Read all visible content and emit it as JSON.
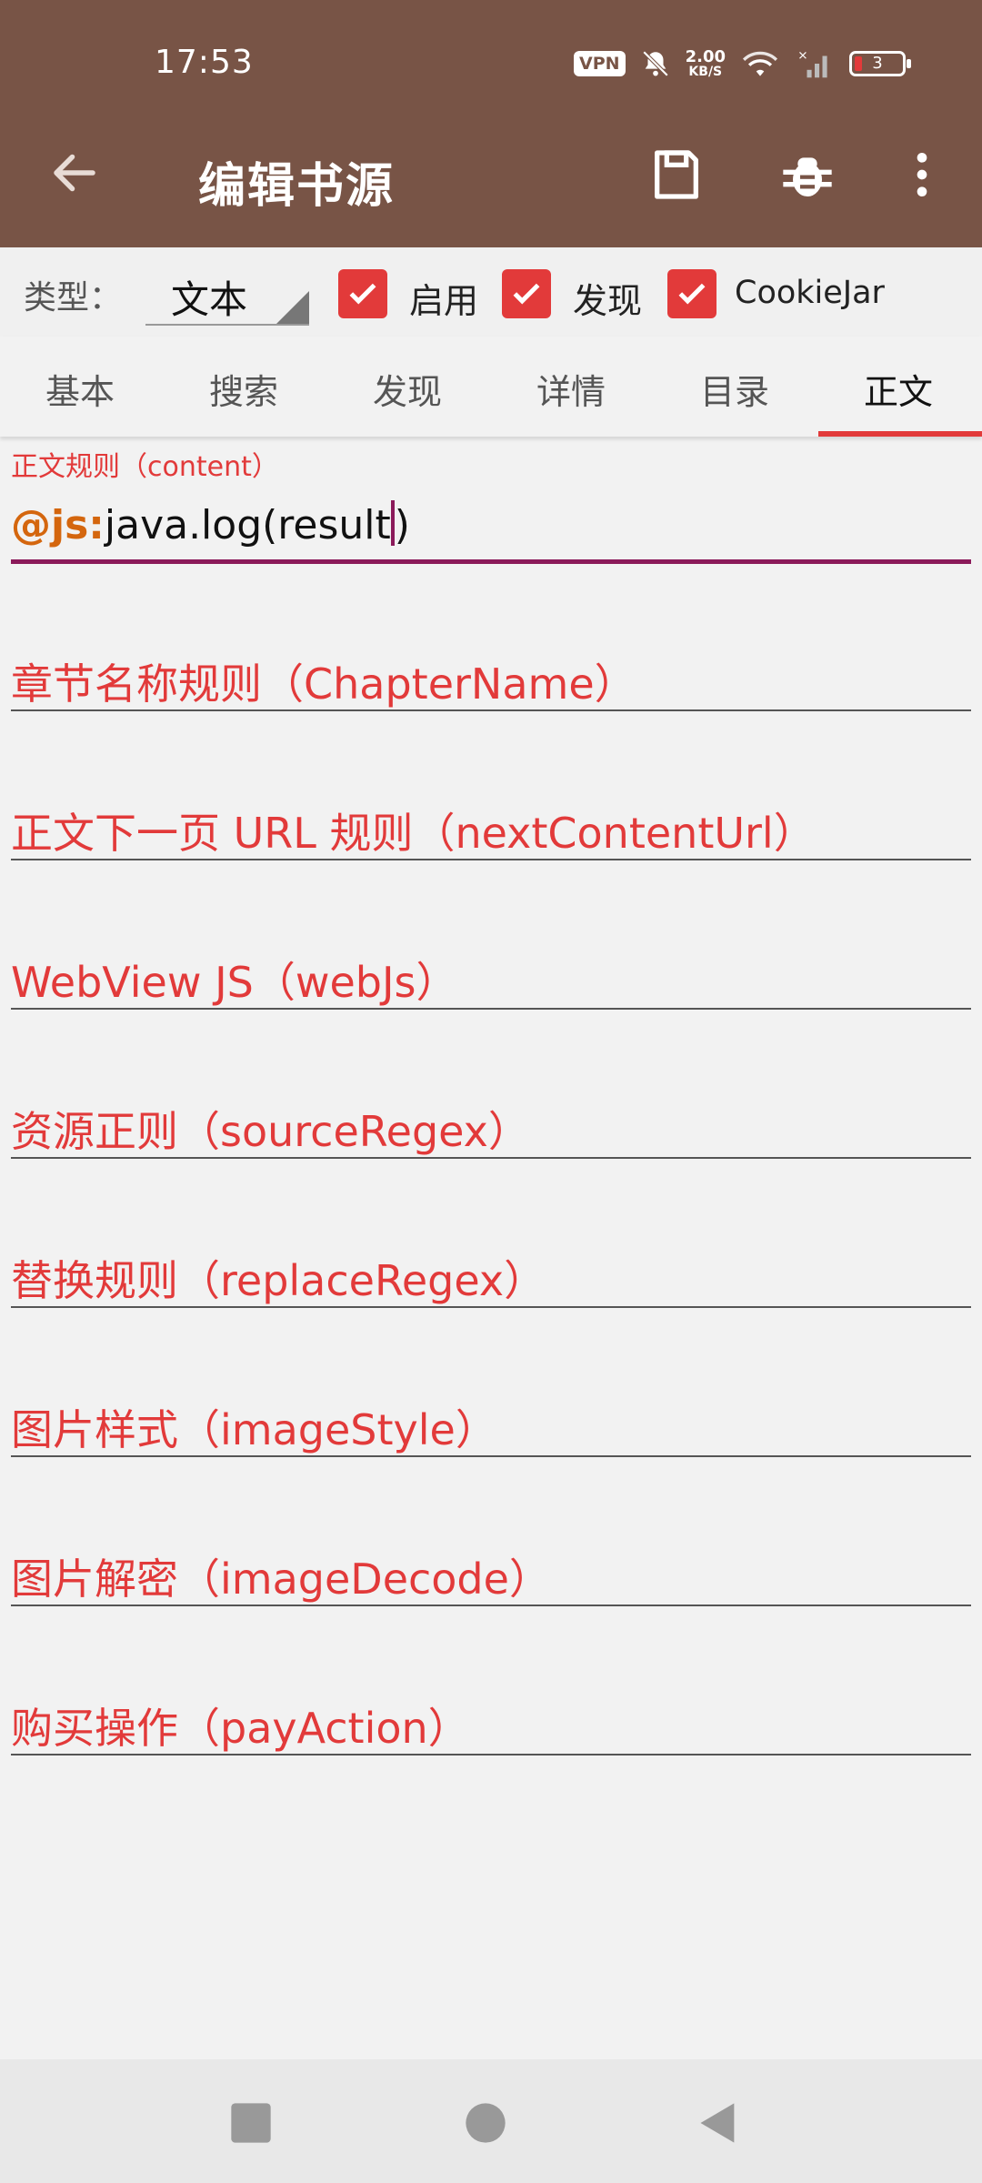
{
  "status_bar": {
    "time": "17:53",
    "vpn": "VPN",
    "speed_value": "2.00",
    "speed_unit": "KB/S",
    "battery": "3"
  },
  "toolbar": {
    "title": "编辑书源",
    "back_icon": "arrow-left-icon",
    "save_icon": "save-icon",
    "debug_icon": "bug-icon",
    "more_icon": "more-vert-icon"
  },
  "options": {
    "type_label": "类型：",
    "type_value": "文本",
    "enable_label": "启用",
    "discover_label": "发现",
    "cookie_label": "CookieJar",
    "enable_checked": true,
    "discover_checked": true,
    "cookie_checked": true
  },
  "tabs": [
    {
      "label": "基本"
    },
    {
      "label": "搜索"
    },
    {
      "label": "发现"
    },
    {
      "label": "详情"
    },
    {
      "label": "目录"
    },
    {
      "label": "正文"
    }
  ],
  "active_tab": "正文",
  "content_field": {
    "label": "正文规则（content）",
    "prefix": "@js:",
    "value": "java.log(result"
  },
  "fields": [
    {
      "label": "章节名称规则（ChapterName）"
    },
    {
      "label": "正文下一页 URL 规则（nextContentUrl）"
    },
    {
      "label": "WebView JS（webJs）"
    },
    {
      "label": "资源正则（sourceRegex）"
    },
    {
      "label": "替换规则（replaceRegex）"
    },
    {
      "label": "图片样式（imageStyle）"
    },
    {
      "label": "图片解密（imageDecode）"
    },
    {
      "label": "购买操作（payAction）"
    }
  ],
  "colors": {
    "appbar": "#785446",
    "accent": "#e23a3a",
    "focus_underline": "#8b1a5a",
    "js_prefix": "#d4660e"
  }
}
